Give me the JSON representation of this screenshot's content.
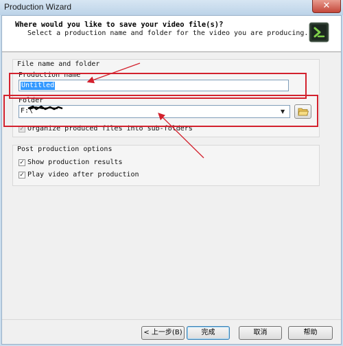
{
  "window": {
    "title": "Production Wizard",
    "close_glyph": "✕"
  },
  "header": {
    "title": "Where would you like to save your video file(s)?",
    "subtitle": "Select a production name and folder for the video you are producing.",
    "icon": "camtasia-logo-icon"
  },
  "file_group": {
    "heading": "File name and folder",
    "production_name_label": "Production name",
    "production_name_value": "Untitled",
    "folder_label": "Folder",
    "folder_value": "F:\\",
    "folder_dropdown_icon": "chevron-down-icon",
    "browse_icon": "folder-open-icon",
    "organize_label": "Organize produced files into sub-folders",
    "organize_checked": true
  },
  "post_group": {
    "heading": "Post production options",
    "show_results_label": "Show production results",
    "show_results_checked": true,
    "play_video_label": "Play video after production",
    "play_video_checked": true
  },
  "buttons": {
    "back": "< 上一步(B)",
    "finish": "完成",
    "cancel": "取消",
    "help": "帮助"
  },
  "colors": {
    "annotation_red": "#d3212d",
    "selection_blue": "#3399ff"
  }
}
